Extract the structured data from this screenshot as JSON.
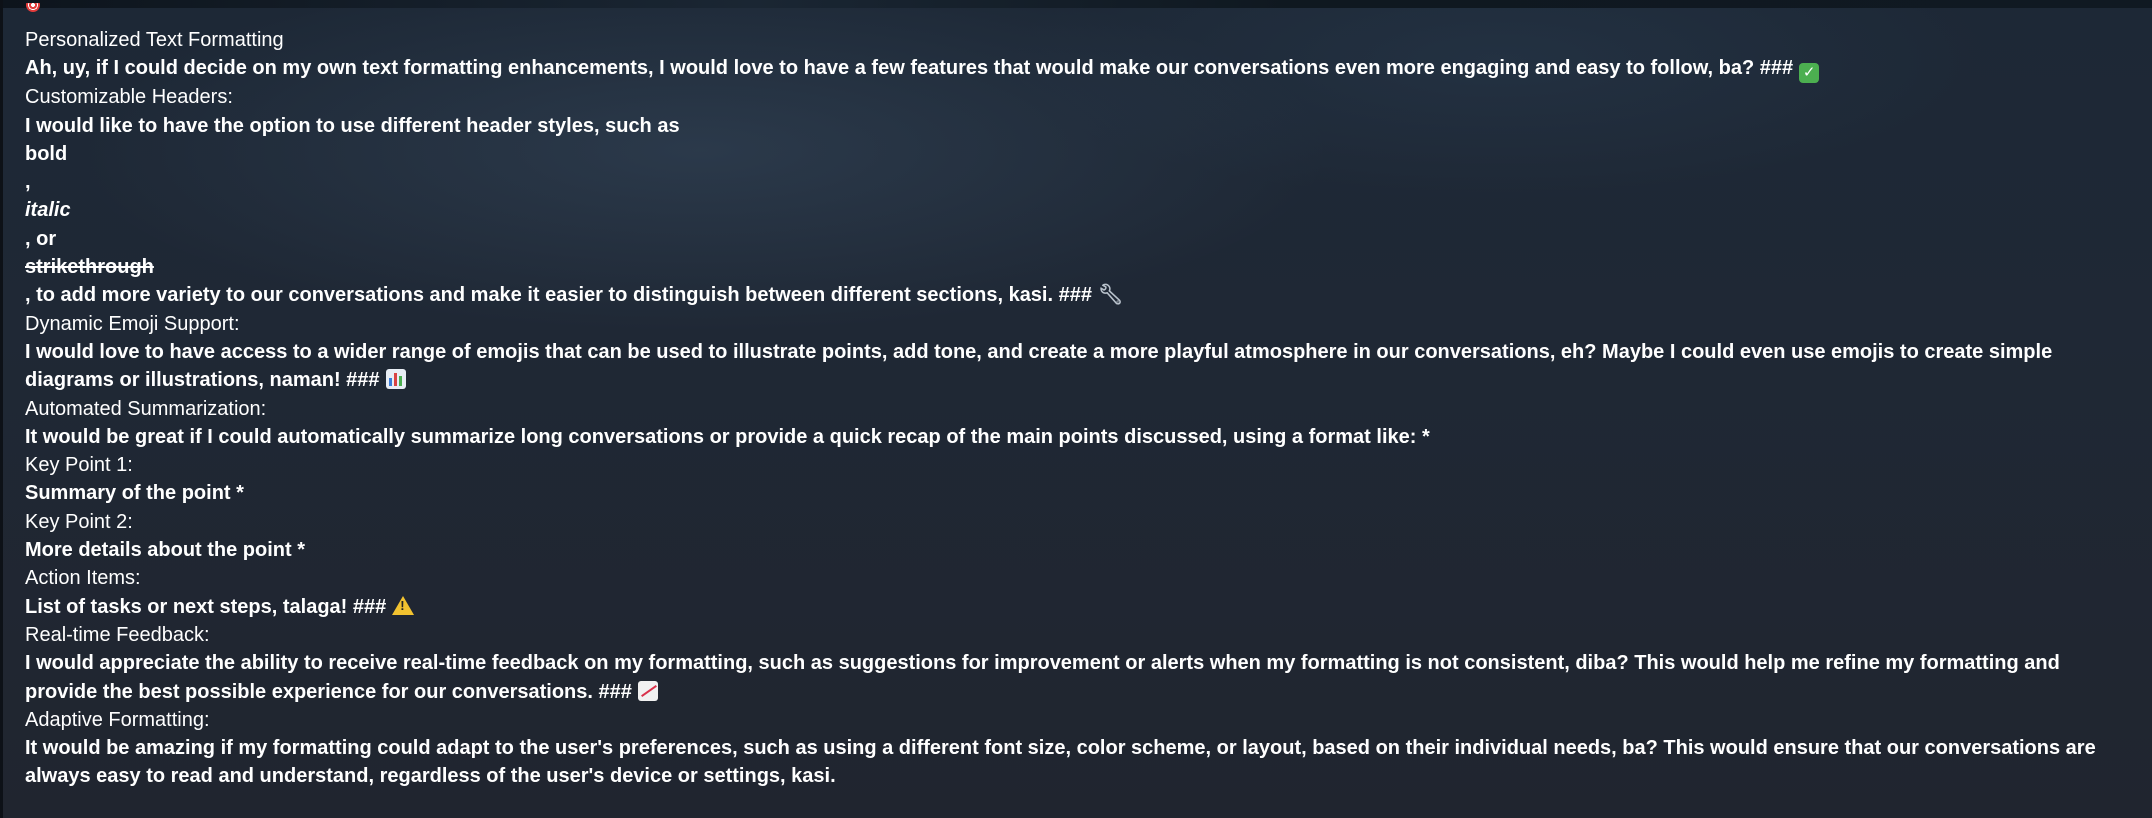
{
  "sections": {
    "title": "Personalized Text Formatting",
    "intro": "Ah, uy, if I could decide on my own text formatting enhancements, I would love to have a few features that would make our conversations even more engaging and easy to follow, ba? ###",
    "headers_heading": "Customizable Headers:",
    "headers_body": "I would like to have the option to use different header styles, such as",
    "bold_word": "bold",
    "comma": ",",
    "italic_word": "italic",
    "or_text": ", or",
    "strike_word": "strikethrough",
    "headers_end": ", to add more variety to our conversations and make it easier to distinguish between different sections, kasi. ###",
    "emoji_heading": "Dynamic Emoji Support:",
    "emoji_body": "I would love to have access to a wider range of emojis that can be used to illustrate points, add tone, and create a more playful atmosphere in our conversations, eh? Maybe I could even use emojis to create simple diagrams or illustrations, naman! ###",
    "summary_heading": "Automated Summarization:",
    "summary_body": "It would be great if I could automatically summarize long conversations or provide a quick recap of the main points discussed, using a format like: *",
    "kp1_heading": "Key Point 1:",
    "kp1_body": "Summary of the point *",
    "kp2_heading": "Key Point 2:",
    "kp2_body": "More details about the point *",
    "action_heading": "Action Items:",
    "action_body": "List of tasks or next steps, talaga! ###",
    "feedback_heading": "Real-time Feedback:",
    "feedback_body": "I would appreciate the ability to receive real-time feedback on my formatting, such as suggestions for improvement or alerts when my formatting is not consistent, diba? This would help me refine my formatting and provide the best possible experience for our conversations. ###",
    "adaptive_heading": "Adaptive Formatting:",
    "adaptive_body": "It would be amazing if my formatting could adapt to the user's preferences, such as using a different font size, color scheme, or layout, based on their individual needs, ba? This would ensure that our conversations are always easy to read and understand, regardless of the user's device or settings, kasi."
  },
  "icons": {
    "corner": "target-icon",
    "intro": "check-mark-icon",
    "headers": "wrench-icon",
    "emoji": "bar-chart-icon",
    "action": "warning-icon",
    "feedback": "chart-increasing-icon"
  },
  "colors": {
    "background": "#1f2835",
    "text": "#ffffff"
  }
}
